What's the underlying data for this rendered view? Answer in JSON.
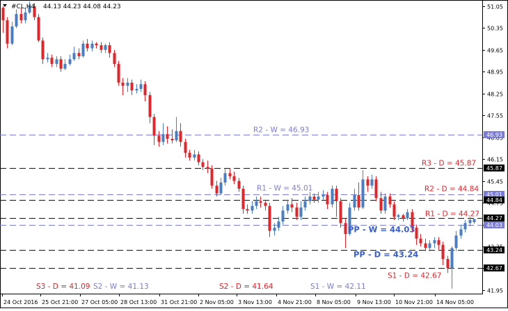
{
  "header": {
    "symbol": "#CL,H4",
    "ohlc": "44.13 44.23 44.08 44.23"
  },
  "colors": {
    "bull": "#4a7dc2",
    "bear": "#e3242b",
    "daily_pivot": "#111111",
    "weekly_pivot": "#7b7bd8",
    "label_daily": "#e3242b",
    "label_weekly": "#7b7bd8",
    "label_pp": "#3a5fcd"
  },
  "chart_data": {
    "type": "candlestick",
    "y_range": [
      41.86,
      51.16
    ],
    "y_ticks": [
      "51.05",
      "50.35",
      "49.65",
      "48.95",
      "48.25",
      "47.55",
      "46.85",
      "46.15",
      "45.45",
      "44.75",
      "44.05",
      "43.35",
      "42.65",
      "41.95"
    ],
    "x_labels": [
      "24 Oct 2016",
      "25 Oct 21:00",
      "27 Oct 05:00",
      "28 Oct 13:00",
      "31 Oct 21:00",
      "2 Nov 05:00",
      "3 Nov 13:00",
      "4 Nov 21:00",
      "8 Nov 05:00",
      "9 Nov 13:00",
      "10 Nov 21:00",
      "14 Nov 05:00"
    ],
    "price_labels": [
      "46.93",
      "45.87",
      "45.01",
      "44.84",
      "44.27",
      "44.03",
      "43.24",
      "42.67"
    ],
    "levels": [
      {
        "label": "S3 - D = 41.09",
        "value": 41.09,
        "kind": "daily",
        "line": false
      },
      {
        "label": "S2 - D = 41.64",
        "value": 41.64,
        "kind": "daily",
        "line": false
      },
      {
        "label": "S1 - D = 42.67",
        "value": 42.67,
        "kind": "daily",
        "line": true
      },
      {
        "label": "PP - D = 43.24",
        "value": 43.24,
        "kind": "pp",
        "line": true
      },
      {
        "label": "R1 - D = 44.27",
        "value": 44.27,
        "kind": "daily",
        "line": true
      },
      {
        "label": "R2 - D = 44.84",
        "value": 44.84,
        "kind": "daily",
        "line": true
      },
      {
        "label": "R3 - D = 45.87",
        "value": 45.87,
        "kind": "daily",
        "line": true
      },
      {
        "label": "S2 - W = 41.13",
        "value": 41.13,
        "kind": "weekly",
        "line": false
      },
      {
        "label": "S1 - W = 42.11",
        "value": 42.11,
        "kind": "weekly",
        "line": false
      },
      {
        "label": "PP - W = 44.03",
        "value": 44.03,
        "kind": "pp",
        "line": true
      },
      {
        "label": "R1 - W = 45.01",
        "value": 45.01,
        "kind": "weekly",
        "line": true
      },
      {
        "label": "R2 - W = 46.93",
        "value": 46.93,
        "kind": "weekly",
        "line": true
      }
    ],
    "candles": [
      [
        51.0,
        50.6,
        51.05,
        50.2
      ],
      [
        50.6,
        49.85,
        50.7,
        49.7
      ],
      [
        49.85,
        50.4,
        50.55,
        49.8
      ],
      [
        50.4,
        50.8,
        50.95,
        50.35
      ],
      [
        50.8,
        50.6,
        51.0,
        50.5
      ],
      [
        50.6,
        50.85,
        51.0,
        50.5
      ],
      [
        50.85,
        51.05,
        51.2,
        50.8
      ],
      [
        51.05,
        50.7,
        51.15,
        50.6
      ],
      [
        50.7,
        49.95,
        50.8,
        49.9
      ],
      [
        49.95,
        49.35,
        50.05,
        49.2
      ],
      [
        49.35,
        49.4,
        49.55,
        49.25
      ],
      [
        49.4,
        49.2,
        49.5,
        49.1
      ],
      [
        49.2,
        49.35,
        49.45,
        49.1
      ],
      [
        49.35,
        49.05,
        49.45,
        48.95
      ],
      [
        49.05,
        49.2,
        49.35,
        49.0
      ],
      [
        49.2,
        49.35,
        49.5,
        49.15
      ],
      [
        49.35,
        49.55,
        49.75,
        49.3
      ],
      [
        49.55,
        49.45,
        49.7,
        49.35
      ],
      [
        49.45,
        49.85,
        49.95,
        49.4
      ],
      [
        49.85,
        49.7,
        50.0,
        49.6
      ],
      [
        49.7,
        49.85,
        49.95,
        49.6
      ],
      [
        49.85,
        49.8,
        49.9,
        49.7
      ],
      [
        49.8,
        49.65,
        49.9,
        49.55
      ],
      [
        49.65,
        49.8,
        49.85,
        49.55
      ],
      [
        49.8,
        49.55,
        49.9,
        49.4
      ],
      [
        49.55,
        49.2,
        49.65,
        49.1
      ],
      [
        49.2,
        48.6,
        49.3,
        48.5
      ],
      [
        48.6,
        48.5,
        48.75,
        48.2
      ],
      [
        48.5,
        48.6,
        48.75,
        48.3
      ],
      [
        48.6,
        48.35,
        48.7,
        48.2
      ],
      [
        48.35,
        48.4,
        48.55,
        48.25
      ],
      [
        48.4,
        48.55,
        48.7,
        48.3
      ],
      [
        48.55,
        48.2,
        48.65,
        48.0
      ],
      [
        48.2,
        47.5,
        48.3,
        47.3
      ],
      [
        47.5,
        46.9,
        47.6,
        46.6
      ],
      [
        46.9,
        46.7,
        47.05,
        46.55
      ],
      [
        46.7,
        46.95,
        47.3,
        46.6
      ],
      [
        46.95,
        46.8,
        47.2,
        46.65
      ],
      [
        46.8,
        46.75,
        47.1,
        46.65
      ],
      [
        46.75,
        47.05,
        47.5,
        46.7
      ],
      [
        47.05,
        46.7,
        47.3,
        46.55
      ],
      [
        46.7,
        46.35,
        46.8,
        46.2
      ],
      [
        46.35,
        46.2,
        46.45,
        46.1
      ],
      [
        46.2,
        46.3,
        46.45,
        46.1
      ],
      [
        46.3,
        46.05,
        46.4,
        45.95
      ],
      [
        46.05,
        45.9,
        46.15,
        45.8
      ],
      [
        45.9,
        45.85,
        46.1,
        45.7
      ],
      [
        45.85,
        45.3,
        45.95,
        45.2
      ],
      [
        45.3,
        45.05,
        45.45,
        44.95
      ],
      [
        45.05,
        45.4,
        45.55,
        45.0
      ],
      [
        45.4,
        45.7,
        45.85,
        45.3
      ],
      [
        45.7,
        45.6,
        45.85,
        45.5
      ],
      [
        45.6,
        45.45,
        45.75,
        45.35
      ],
      [
        45.45,
        45.2,
        45.55,
        45.1
      ],
      [
        45.2,
        44.55,
        45.3,
        44.4
      ],
      [
        44.55,
        44.5,
        44.7,
        44.4
      ],
      [
        44.5,
        44.65,
        44.8,
        44.4
      ],
      [
        44.65,
        44.8,
        44.95,
        44.55
      ],
      [
        44.8,
        44.75,
        44.95,
        44.6
      ],
      [
        44.75,
        44.65,
        44.85,
        44.5
      ],
      [
        44.65,
        43.85,
        44.75,
        43.65
      ],
      [
        43.85,
        43.95,
        44.1,
        43.7
      ],
      [
        43.95,
        44.15,
        44.3,
        43.85
      ],
      [
        44.15,
        44.5,
        44.65,
        44.05
      ],
      [
        44.5,
        44.7,
        44.85,
        44.4
      ],
      [
        44.7,
        44.6,
        44.9,
        44.45
      ],
      [
        44.6,
        44.3,
        44.75,
        44.2
      ],
      [
        44.3,
        44.6,
        44.8,
        44.2
      ],
      [
        44.6,
        44.8,
        44.95,
        44.5
      ],
      [
        44.8,
        44.95,
        45.1,
        44.7
      ],
      [
        44.95,
        44.85,
        45.05,
        44.75
      ],
      [
        44.85,
        44.95,
        45.1,
        44.75
      ],
      [
        44.95,
        45.0,
        45.15,
        44.85
      ],
      [
        45.0,
        44.7,
        45.1,
        44.55
      ],
      [
        44.7,
        45.2,
        45.3,
        44.6
      ],
      [
        45.2,
        44.8,
        45.3,
        44.3
      ],
      [
        44.8,
        44.1,
        44.9,
        43.95
      ],
      [
        44.1,
        43.75,
        44.25,
        43.3
      ],
      [
        43.75,
        44.6,
        44.75,
        43.7
      ],
      [
        44.6,
        45.0,
        45.2,
        44.5
      ],
      [
        45.0,
        44.6,
        45.4,
        44.5
      ],
      [
        44.6,
        45.5,
        45.8,
        44.55
      ],
      [
        45.5,
        45.3,
        45.6,
        45.1
      ],
      [
        45.3,
        45.5,
        45.65,
        45.2
      ],
      [
        45.5,
        44.9,
        45.6,
        44.8
      ],
      [
        44.9,
        44.5,
        45.1,
        44.4
      ],
      [
        44.5,
        44.95,
        45.05,
        44.4
      ],
      [
        44.95,
        44.7,
        45.05,
        44.6
      ],
      [
        44.7,
        44.3,
        44.8,
        44.2
      ],
      [
        44.3,
        44.35,
        44.4,
        44.2
      ],
      [
        44.35,
        44.25,
        44.4,
        44.15
      ],
      [
        44.25,
        44.45,
        44.55,
        44.2
      ],
      [
        44.45,
        43.95,
        44.55,
        43.8
      ],
      [
        43.95,
        43.6,
        44.05,
        43.4
      ],
      [
        43.6,
        43.45,
        43.75,
        43.35
      ],
      [
        43.45,
        43.3,
        43.6,
        43.2
      ],
      [
        43.3,
        43.45,
        43.55,
        43.2
      ],
      [
        43.45,
        43.55,
        43.65,
        43.3
      ],
      [
        43.55,
        43.4,
        43.65,
        43.25
      ],
      [
        43.4,
        42.95,
        43.5,
        42.75
      ],
      [
        42.95,
        42.65,
        43.05,
        42.5
      ],
      [
        42.65,
        43.3,
        43.35,
        42.0
      ],
      [
        43.3,
        43.7,
        43.85,
        43.2
      ],
      [
        43.7,
        43.9,
        44.05,
        43.6
      ],
      [
        43.9,
        44.1,
        44.2,
        43.8
      ],
      [
        44.1,
        44.2,
        44.3,
        44.0
      ],
      [
        44.13,
        44.23,
        44.23,
        44.08
      ]
    ]
  }
}
